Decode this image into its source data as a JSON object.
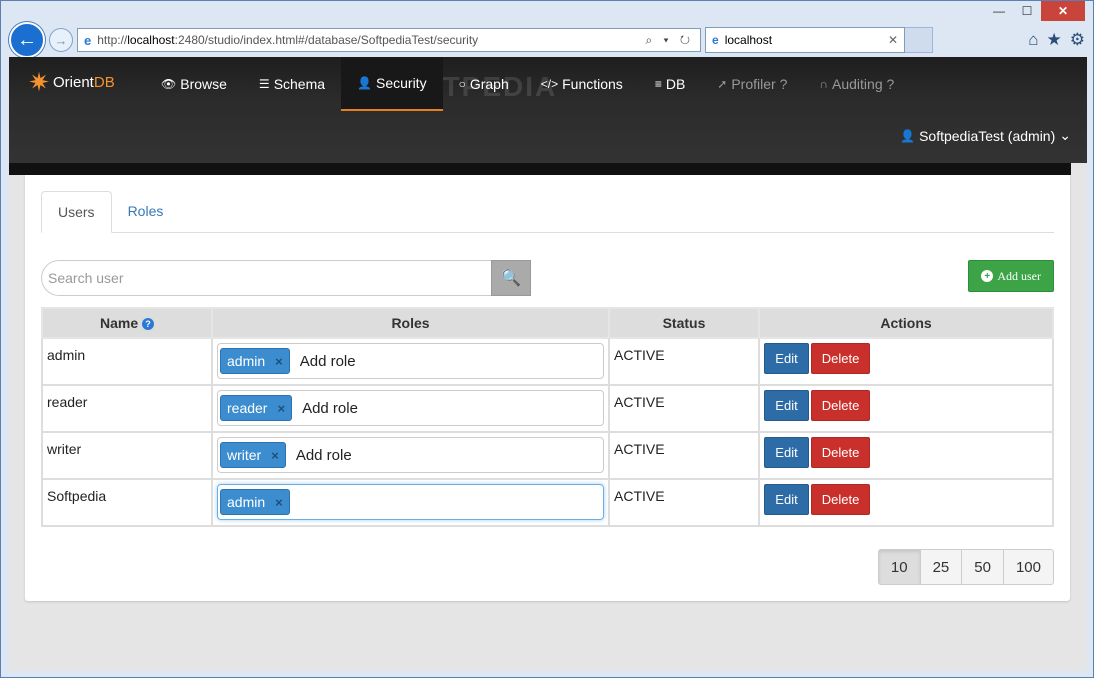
{
  "browser": {
    "url_prefix": "http://",
    "url_host": "localhost",
    "url_rest": ":2480/studio/index.html#/database/SoftpediaTest/security",
    "url_tools": "⌕ ▾ ↻",
    "tab_title": "localhost",
    "minimize": "—",
    "maximize": "☐",
    "close": "✕",
    "tab_close": "✕",
    "back_icon": "←",
    "forward_icon": "→",
    "home_icon": "⌂",
    "favorites_icon": "★",
    "settings_icon": "⚙"
  },
  "brand": {
    "prefix": "Orient",
    "suffix": "DB",
    "mark": "✷"
  },
  "nav": {
    "items": [
      {
        "label": "Browse",
        "icon": "👁"
      },
      {
        "label": "Schema",
        "icon": "☰"
      },
      {
        "label": "Security",
        "icon": "👤"
      },
      {
        "label": "Graph",
        "icon": "○"
      },
      {
        "label": "Functions",
        "icon": "</>"
      },
      {
        "label": "DB",
        "icon": "≡"
      },
      {
        "label": "Profiler",
        "icon": "➚",
        "help": "?"
      },
      {
        "label": "Auditing",
        "icon": "∩",
        "help": "?"
      }
    ],
    "user_label": "SoftpediaTest (admin)",
    "user_icon": "👤",
    "user_chevron": "⌄"
  },
  "watermark": "SOFTPEDIA",
  "tabs": [
    {
      "label": "Users"
    },
    {
      "label": "Roles"
    }
  ],
  "search": {
    "placeholder": "Search user",
    "icon": "🔍"
  },
  "add_user": {
    "label": "Add user",
    "icon": "+"
  },
  "table": {
    "headers": {
      "name": "Name",
      "name_help": "?",
      "roles": "Roles",
      "status": "Status",
      "actions": "Actions"
    },
    "add_role_label": "Add role",
    "tag_remove": "×",
    "edit_label": "Edit",
    "delete_label": "Delete",
    "rows": [
      {
        "name": "admin",
        "role": "admin",
        "status": "ACTIVE"
      },
      {
        "name": "reader",
        "role": "reader",
        "status": "ACTIVE"
      },
      {
        "name": "writer",
        "role": "writer",
        "status": "ACTIVE"
      },
      {
        "name": "Softpedia",
        "role": "admin",
        "status": "ACTIVE"
      }
    ]
  },
  "pager": [
    "10",
    "25",
    "50",
    "100"
  ]
}
